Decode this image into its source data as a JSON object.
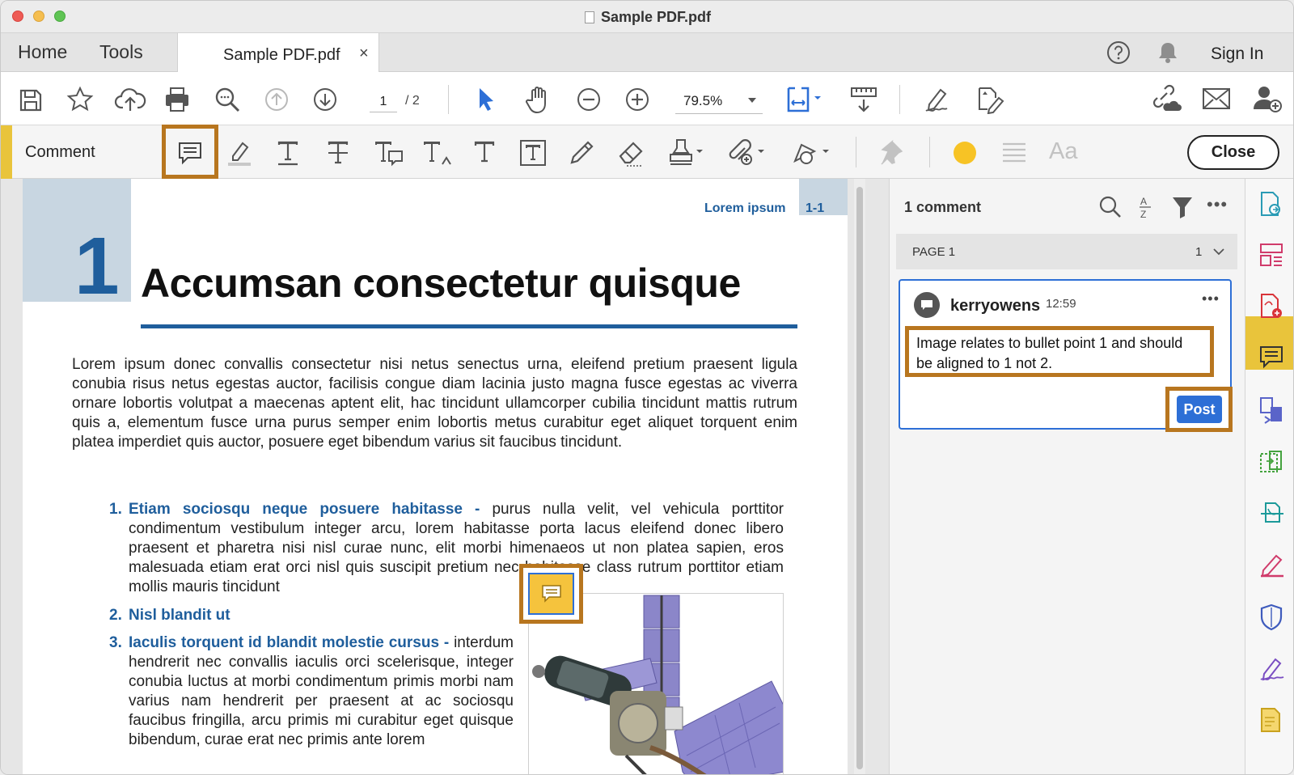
{
  "window": {
    "title": "Sample PDF.pdf"
  },
  "tabs": {
    "home": "Home",
    "tools": "Tools",
    "document": "Sample PDF.pdf",
    "close_glyph": "×",
    "sign_in": "Sign In"
  },
  "toolbar": {
    "page_current": "1",
    "page_total": "/ 2",
    "zoom": "79.5%"
  },
  "comment_toolbar": {
    "label": "Comment",
    "close_button": "Close",
    "active_tool": "add-sticky-note",
    "color": "#f7c325"
  },
  "document": {
    "running_head": "Lorem ipsum",
    "running_number": "1-1",
    "chapter_number": "1",
    "heading": "Accumsan consectetur quisque",
    "paragraph": "Lorem ipsum donec convallis consectetur nisi netus senectus urna, eleifend pretium praesent ligula conubia risus netus egestas auctor, facilisis congue diam lacinia justo magna fusce egestas ac viverra ornare lobortis volutpat a maecenas aptent elit, hac tincidunt ullamcorper cubilia tincidunt mattis rutrum quis a, elementum fusce urna purus semper enim lobortis metus curabitur eget aliquet torquent enim platea imperdiet quis auctor, posuere eget bibendum varius sit faucibus tincidunt.",
    "list": [
      {
        "num": "1.",
        "head": "Etiam sociosqu neque posuere habitasse -",
        "body": " purus nulla velit, vel vehicula porttitor condimentum vestibulum integer arcu, lorem habitasse porta lacus eleifend donec libero praesent et pharetra nisi nisl curae nunc, elit morbi himenaeos ut non platea sapien, eros malesuada etiam erat orci nisl quis suscipit pretium nec habitasse class rutrum porttitor etiam mollis mauris tincidunt"
      },
      {
        "num": "2.",
        "head": "Nisl blandit ut",
        "body": ""
      },
      {
        "num": "3.",
        "head": "Iaculis torquent id blandit molestie cursus -",
        "body": " interdum hendrerit nec convallis iaculis orci scelerisque, integer conubia luctus at morbi condimentum primis morbi nam varius nam hendrerit per praesent at ac sociosqu faucibus fringilla, arcu primis mi curabitur eget quisque bibendum, curae erat nec primis ante lorem"
      }
    ]
  },
  "comments_panel": {
    "count_label": "1 comment",
    "page_group": {
      "label": "PAGE 1",
      "count": "1"
    },
    "comment": {
      "author": "kerryowens",
      "time": "12:59",
      "text": "Image relates to bullet point 1 and should be aligned to 1 not 2.",
      "post_button": "Post"
    }
  },
  "colors": {
    "accent_blue": "#1f5e9c",
    "highlight_border": "#b8761f",
    "comment_yellow": "#e9c43b",
    "selection_blue": "#2d6fd6"
  }
}
